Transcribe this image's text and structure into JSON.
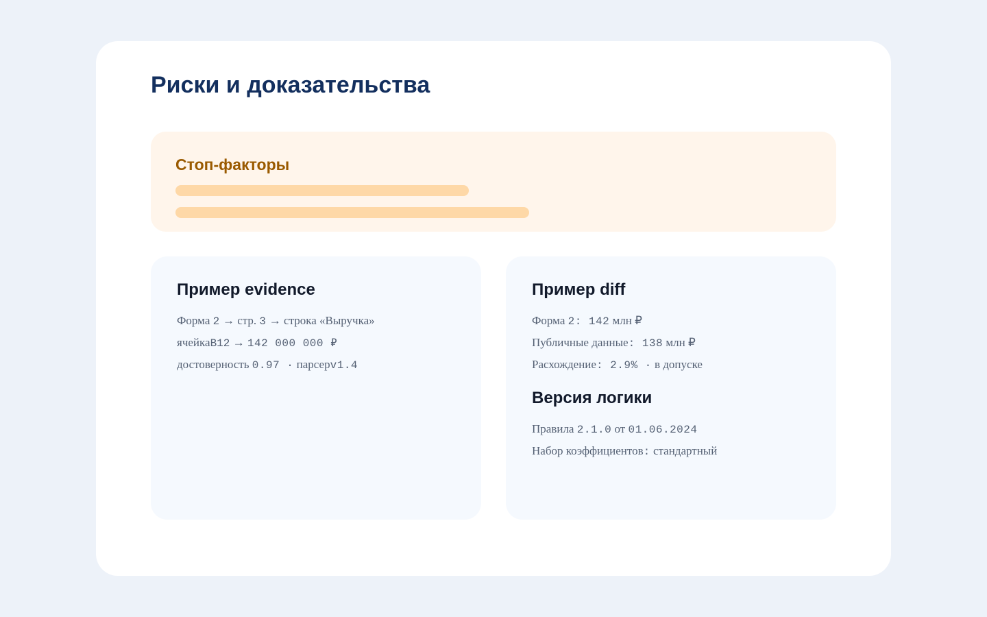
{
  "page": {
    "title": "Риски и доказательства"
  },
  "stop_factors": {
    "title": "Стоп-факторы"
  },
  "evidence": {
    "title": "Пример evidence",
    "line1": {
      "a": "Форма",
      "b": "2",
      "c": "→ стр.",
      "d": "3",
      "e": "→ строка «Выручка»"
    },
    "line2": {
      "a": "ячейка",
      "b": "B12",
      "c": "→",
      "d": "142 000 000 ₽"
    },
    "line3": {
      "a": "достоверность",
      "b": "0.97 ·",
      "c": "парсер",
      "d": "v1.4"
    }
  },
  "diff": {
    "title": "Пример diff",
    "line1": {
      "a": "Форма",
      "b": "2: 142",
      "c": "млн ₽"
    },
    "line2": {
      "a": "Публичные данные",
      "b": ": 138",
      "c": "млн ₽"
    },
    "line3": {
      "a": "Расхождение",
      "b": ": 2.9% ·",
      "c": "в допуске"
    }
  },
  "logic": {
    "title": "Версия логики",
    "line1": {
      "a": "Правила",
      "b": "2.1.0",
      "c": "от",
      "d": "01.06.2024"
    },
    "line2": {
      "a": "Набор коэффициентов",
      "b": ":",
      "c": "стандартный"
    }
  },
  "colors": {
    "background": "#edf2f9",
    "card": "#ffffff",
    "title": "#132f5e",
    "stop_panel": "#fff5eb",
    "stop_title": "#9a5a00",
    "stop_bar": "#fed8a7",
    "info_panel": "#f5f9fe",
    "body_text": "#556174"
  }
}
